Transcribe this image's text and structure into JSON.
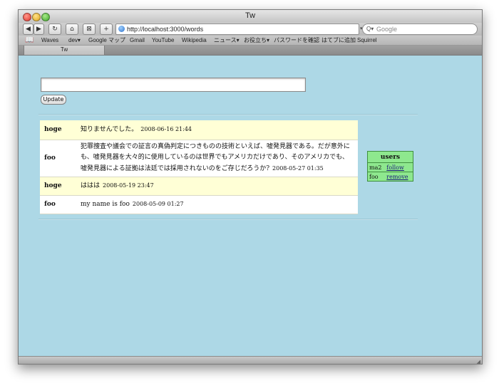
{
  "window": {
    "title": "Tw"
  },
  "toolbar": {
    "back": "◀",
    "forward": "▶",
    "reload": "↻",
    "home": "⌂",
    "snapback": "⊠",
    "add": "+",
    "url": "http://localhost:3000/words",
    "search_placeholder": "Google",
    "search_icon": "Q▾"
  },
  "bookmarks": [
    "Waves",
    "dev▾",
    "Google マップ",
    "Gmail",
    "YouTube",
    "Wikipedia",
    "ニュース▾",
    "お役立ち▾",
    "パスワードを確認",
    "はてブに追加",
    "Squirrel"
  ],
  "tab": {
    "label": "Tw"
  },
  "form": {
    "textarea_value": "",
    "update_label": "Update"
  },
  "words": [
    {
      "user": "hoge",
      "text": "知りませんでした。",
      "time": "2008-06-16 21:44"
    },
    {
      "user": "foo",
      "text": "犯罪捜査や議会での証言の真偽判定につきものの技術といえば、嘘発見器である。だが意外にも、嘘発見器を大々的に使用しているのは世界でもアメリカだけであり、そのアメリカでも、嘘発見器による証拠は法廷では採用されないのをご存じだろうか?",
      "time": "2008-05-27 01:35"
    },
    {
      "user": "hoge",
      "text": "ははは",
      "time": "2008-05-19 23:47"
    },
    {
      "user": "foo",
      "text": "my name is foo",
      "time": "2008-05-09 01:27"
    }
  ],
  "users_panel": {
    "header": "users",
    "rows": [
      {
        "name": "ma2",
        "action": "follow"
      },
      {
        "name": "foo",
        "action": "remove"
      }
    ]
  },
  "colors": {
    "page_bg": "#add8e6",
    "row_hoge_bg": "#ffffd6",
    "row_foo_bg": "#ffffff",
    "users_bg": "#8ee88e"
  }
}
